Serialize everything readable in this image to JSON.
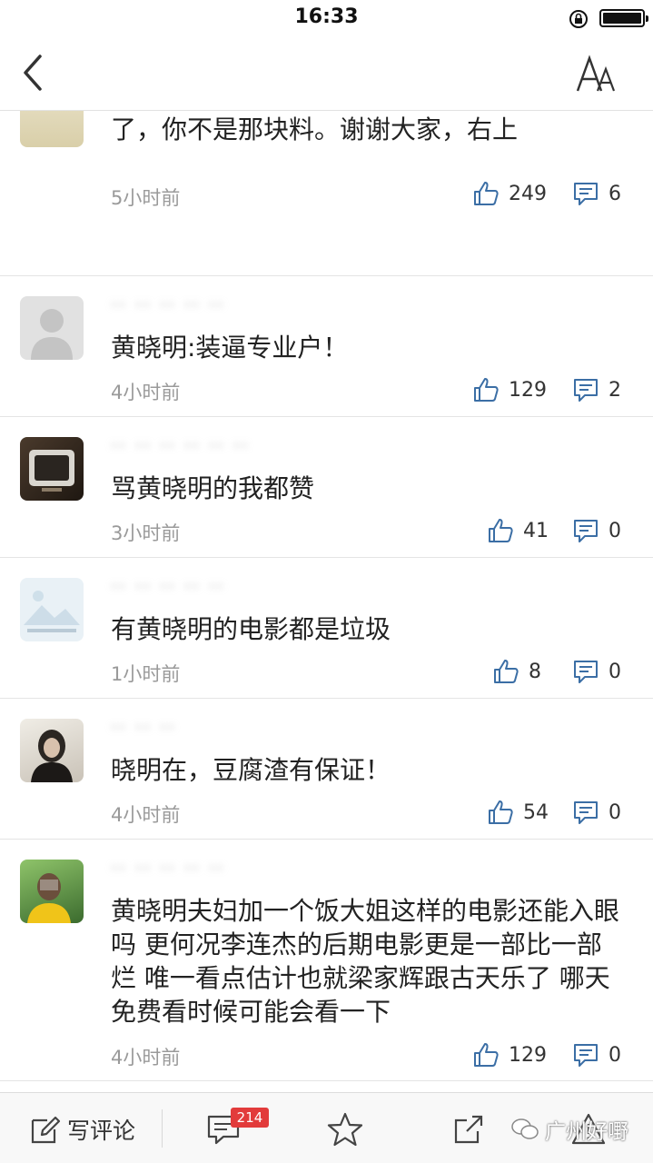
{
  "status_bar": {
    "time": "16:33"
  },
  "nav": {
    "back_icon": "chevron-left-icon",
    "font_icon": "font-size-icon"
  },
  "comments": [
    {
      "username": "",
      "text": "视费电影上映。在这提前说明，给我钱我也不会去看的！也提前祝向佐早日回家，别在闹腾了，你不是那块料。谢谢大家，右上",
      "time": "5小时前",
      "likes": "249",
      "replies": "6"
    },
    {
      "username": "·· ·· ·· ·· ··",
      "text": "黄晓明:装逼专业户！",
      "time": "4小时前",
      "likes": "129",
      "replies": "2"
    },
    {
      "username": "·· ·· ·· ·· ·· ··",
      "text": "骂黄晓明的我都赞",
      "time": "3小时前",
      "likes": "41",
      "replies": "0"
    },
    {
      "username": "·· ·· ·· ·· ··",
      "text": "有黄晓明的电影都是垃圾",
      "time": "1小时前",
      "likes": "8",
      "replies": "0"
    },
    {
      "username": "·· ·· ··",
      "text": "晓明在，豆腐渣有保证！",
      "time": "4小时前",
      "likes": "54",
      "replies": "0"
    },
    {
      "username": "·· ·· ·· ·· ··",
      "text": "黄晓明夫妇加一个饭大姐这样的电影还能入眼吗 更何况李连杰的后期电影更是一部比一部烂 唯一看点估计也就梁家辉跟古天乐了 哪天免费看时候可能会看一下",
      "time": "4小时前",
      "likes": "129",
      "replies": "0"
    }
  ],
  "bottom_bar": {
    "write_label": "写评论",
    "comment_count": "214",
    "watermark": "广州好嘢"
  }
}
